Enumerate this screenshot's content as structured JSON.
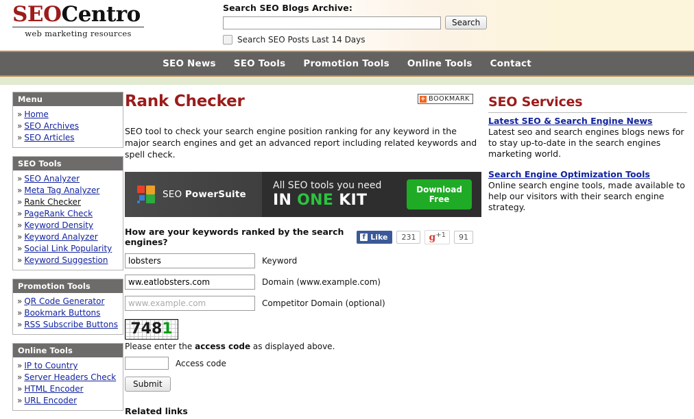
{
  "header": {
    "logo": {
      "seo": "SEO",
      "centro": "Centro",
      "tagline": "web marketing resources"
    },
    "search": {
      "title": "Search SEO Blogs Archive:",
      "value": "",
      "placeholder": "",
      "button_label": "Search",
      "checkbox_label": "Search SEO Posts Last 14 Days",
      "checkbox_checked": false
    }
  },
  "nav": {
    "items": [
      {
        "label": "SEO News"
      },
      {
        "label": "SEO Tools"
      },
      {
        "label": "Promotion Tools"
      },
      {
        "label": "Online Tools"
      },
      {
        "label": "Contact"
      }
    ]
  },
  "sidebar": {
    "boxes": [
      {
        "title": "Menu",
        "items": [
          {
            "label": "Home",
            "current": false
          },
          {
            "label": "SEO Archives",
            "current": false
          },
          {
            "label": "SEO Articles",
            "current": false
          }
        ]
      },
      {
        "title": "SEO Tools",
        "items": [
          {
            "label": "SEO Analyzer",
            "current": false
          },
          {
            "label": "Meta Tag Analyzer",
            "current": false
          },
          {
            "label": "Rank Checker",
            "current": true
          },
          {
            "label": "PageRank Check",
            "current": false
          },
          {
            "label": "Keyword Density",
            "current": false
          },
          {
            "label": "Keyword Analyzer",
            "current": false
          },
          {
            "label": "Social Link Popularity",
            "current": false
          },
          {
            "label": "Keyword Suggestion",
            "current": false
          }
        ]
      },
      {
        "title": "Promotion Tools",
        "items": [
          {
            "label": "QR Code Generator",
            "current": false
          },
          {
            "label": "Bookmark Buttons",
            "current": false
          },
          {
            "label": "RSS Subscribe Buttons",
            "current": false
          }
        ]
      },
      {
        "title": "Online Tools",
        "items": [
          {
            "label": "IP to Country",
            "current": false
          },
          {
            "label": "Server Headers Check",
            "current": false
          },
          {
            "label": "HTML Encoder",
            "current": false
          },
          {
            "label": "URL Encoder",
            "current": false
          }
        ]
      }
    ],
    "bullet": "»"
  },
  "main": {
    "page_title": "Rank Checker",
    "bookmark_label": "BOOKMARK",
    "bookmark_icon_glyph": "+",
    "intro": "SEO tool to check your search engine position ranking for any keyword in the major search engines and get an advanced report including related keywords and spell check.",
    "banner": {
      "brand_light": "SEO",
      "brand_bold": "PowerSuite",
      "line1": "All SEO tools you need",
      "line2_a": "IN",
      "line2_b": "ONE",
      "line2_c": "KIT",
      "cta_line1": "Download",
      "cta_line2": "Free"
    },
    "form": {
      "question": "How are your keywords ranked by the search engines?",
      "fields": [
        {
          "value": "lobsters",
          "placeholder": "",
          "label": "Keyword"
        },
        {
          "value": "ww.eatlobsters.com",
          "placeholder": "",
          "label": "Domain (www.example.com)"
        },
        {
          "value": "",
          "placeholder": "www.example.com",
          "label": "Competitor Domain (optional)"
        }
      ],
      "captcha": {
        "digits_dark": "748",
        "digit_green": "1",
        "full": "7481"
      },
      "captcha_note_a": "Please enter the ",
      "captcha_note_b": "access code",
      "captcha_note_c": " as displayed above.",
      "access_code_value": "",
      "access_code_label": "Access code",
      "submit_label": "Submit"
    },
    "social": {
      "fb_icon": "f",
      "fb_label": "Like",
      "fb_count": "231",
      "gplus_g": "g",
      "gplus_plus": "+1",
      "gplus_count": "91"
    },
    "related_heading": "Related links"
  },
  "right": {
    "title": "SEO Services",
    "blocks": [
      {
        "link": "Latest SEO & Search Engine News",
        "desc": "Latest seo and search engines blogs news for to stay up-to-date in the search engines marketing world."
      },
      {
        "link": "Search Engine Optimization Tools",
        "desc": "Online search engine tools, made available to help our visitors with their search engine strategy."
      }
    ]
  },
  "colors": {
    "brand_red": "#9c1b1b",
    "nav_gray": "#636260",
    "nav_border": "#c08a55",
    "green_bar": "#e2ead0",
    "link_blue": "#12239e",
    "facebook_blue": "#3b5998",
    "cta_green": "#1fab26",
    "header_cream": "#fdf4dc"
  }
}
